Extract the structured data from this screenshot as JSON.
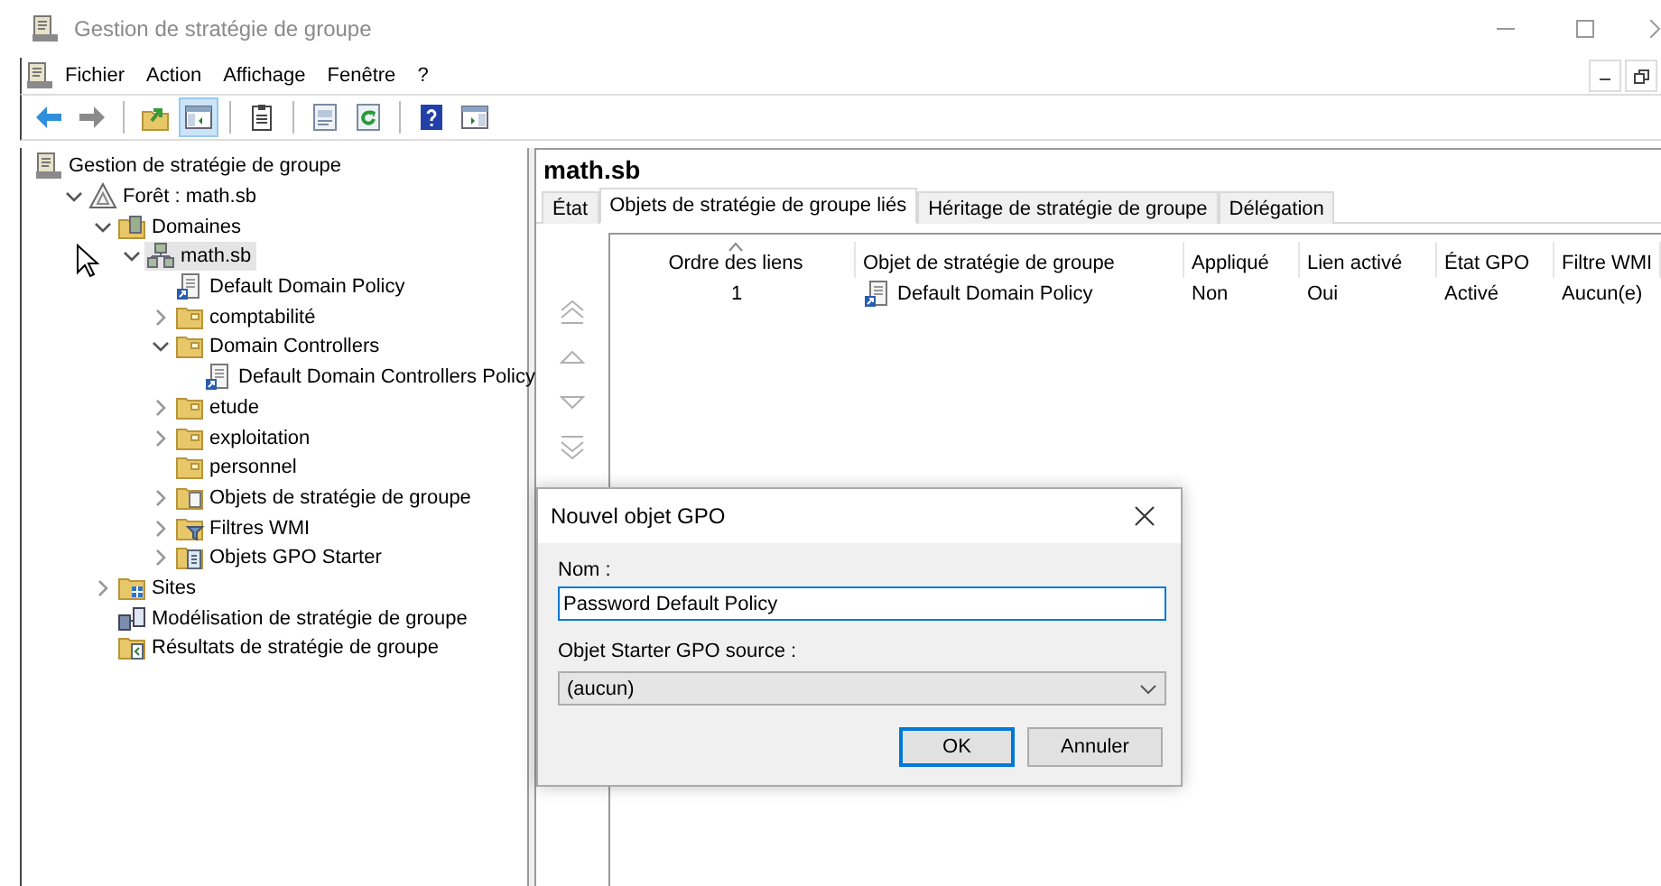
{
  "window": {
    "title": "Gestion de stratégie de groupe"
  },
  "menu": [
    "Fichier",
    "Action",
    "Affichage",
    "Fenêtre",
    "?"
  ],
  "toolbar": [
    [
      {
        "kind": "back",
        "pressed": false
      },
      {
        "kind": "forward",
        "pressed": false
      }
    ],
    [
      {
        "kind": "up",
        "pressed": false
      },
      {
        "kind": "tree",
        "pressed": true
      }
    ],
    [
      {
        "kind": "clipboard",
        "pressed": false
      }
    ],
    [
      {
        "kind": "properties",
        "pressed": false
      },
      {
        "kind": "refresh",
        "pressed": false
      }
    ],
    [
      {
        "kind": "help",
        "pressed": false
      },
      {
        "kind": "console",
        "pressed": false
      }
    ]
  ],
  "tree": [
    {
      "label": "Gestion de stratégie de groupe",
      "kind": "console",
      "selected": false,
      "children": [
        {
          "label": "Forêt : math.sb",
          "kind": "forest",
          "expanded": true,
          "selected": false,
          "children": [
            {
              "label": "Domaines",
              "kind": "domains",
              "expanded": true,
              "selected": false,
              "children": [
                {
                  "label": "math.sb",
                  "kind": "domain",
                  "expanded": true,
                  "selected": true,
                  "children": [
                    {
                      "label": "Default Domain Policy",
                      "kind": "gpo",
                      "selected": false
                    },
                    {
                      "label": "comptabilité",
                      "kind": "folder",
                      "expanded": false,
                      "selected": false
                    },
                    {
                      "label": "Domain Controllers",
                      "kind": "folder",
                      "expanded": true,
                      "selected": false,
                      "children": [
                        {
                          "label": "Default Domain Controllers Policy",
                          "kind": "gpo",
                          "selected": false
                        }
                      ]
                    },
                    {
                      "label": "etude",
                      "kind": "folder",
                      "expanded": false,
                      "selected": false
                    },
                    {
                      "label": "exploitation",
                      "kind": "folder",
                      "expanded": false,
                      "selected": false
                    },
                    {
                      "label": "personnel",
                      "kind": "folder",
                      "selected": false
                    },
                    {
                      "label": "Objets de stratégie de groupe",
                      "kind": "gpo-folder",
                      "expanded": false,
                      "selected": false
                    },
                    {
                      "label": "Filtres WMI",
                      "kind": "filter-folder",
                      "expanded": false,
                      "selected": false
                    },
                    {
                      "label": "Objets GPO Starter",
                      "kind": "starter-folder",
                      "expanded": false,
                      "selected": false
                    }
                  ]
                }
              ]
            },
            {
              "label": "Sites",
              "kind": "sites",
              "expanded": false,
              "selected": false
            },
            {
              "label": "Modélisation de stratégie de groupe",
              "kind": "modeling",
              "selected": false
            },
            {
              "label": "Résultats de stratégie de groupe",
              "kind": "results",
              "selected": false
            }
          ]
        }
      ]
    }
  ],
  "detail": {
    "title": "math.sb",
    "tabs": [
      {
        "label": "État",
        "selected": false
      },
      {
        "label": "Objets de stratégie de groupe liés",
        "selected": true
      },
      {
        "label": "Héritage de stratégie de groupe",
        "selected": false
      },
      {
        "label": "Délégation",
        "selected": false
      }
    ],
    "order_buttons": [
      {
        "kind": "top",
        "disabled": true
      },
      {
        "kind": "up",
        "disabled": true
      },
      {
        "kind": "down",
        "disabled": true
      },
      {
        "kind": "bottom",
        "disabled": true
      }
    ],
    "columns": [
      {
        "label": "Ordre des liens",
        "sorted": true
      },
      {
        "label": "Objet de stratégie de groupe",
        "sorted": false
      },
      {
        "label": "Appliqué",
        "sorted": false
      },
      {
        "label": "Lien activé",
        "sorted": false
      },
      {
        "label": "État GPO",
        "sorted": false
      },
      {
        "label": "Filtre WMI",
        "sorted": false
      }
    ],
    "rows": [
      {
        "cells": [
          "1",
          "Default Domain Policy",
          "Non",
          "Oui",
          "Activé",
          "Aucun(e)"
        ]
      }
    ]
  },
  "dialog": {
    "title": "Nouvel objet GPO",
    "name_label": "Nom :",
    "name_value": "Password Default Policy",
    "source_label": "Objet Starter GPO source :",
    "source_value": "(aucun)",
    "buttons": [
      {
        "label": "OK",
        "default": true
      },
      {
        "label": "Annuler",
        "default": false
      }
    ]
  }
}
